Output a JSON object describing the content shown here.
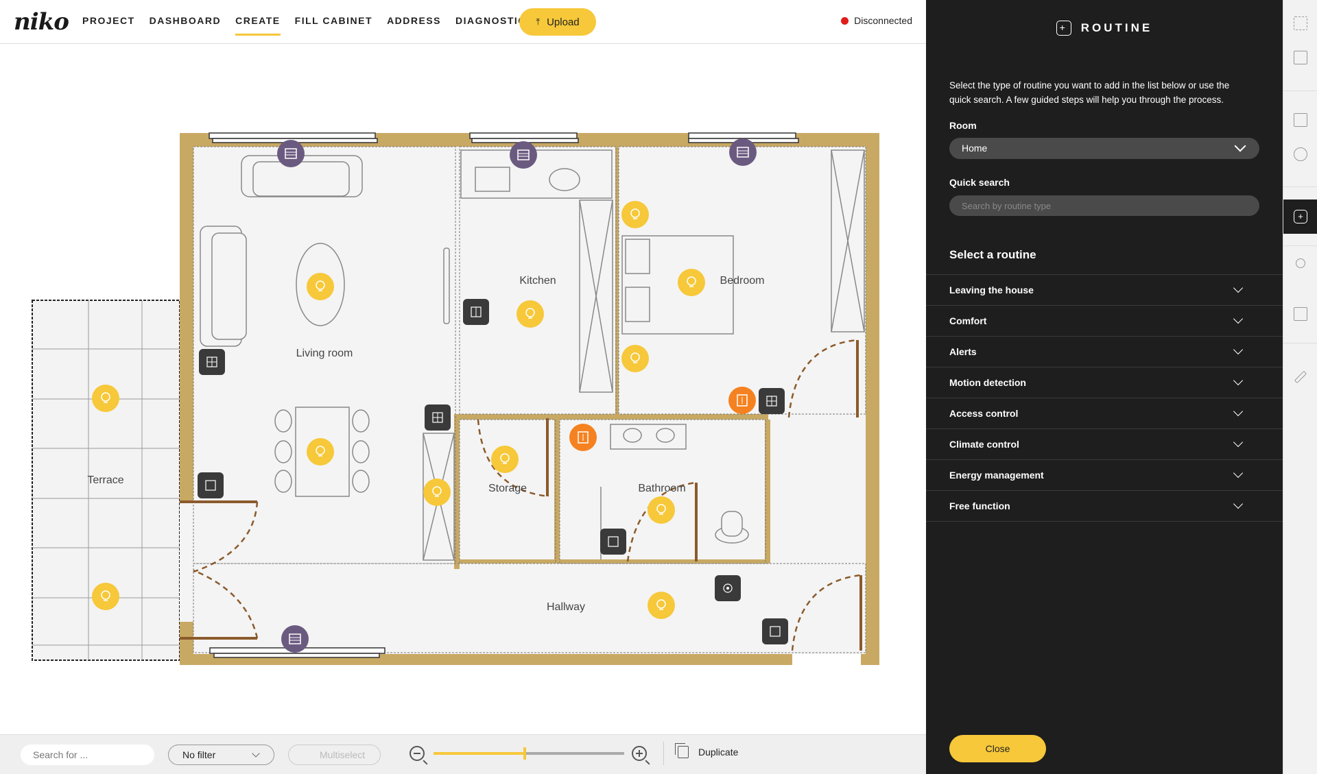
{
  "header": {
    "logo": "niko",
    "nav": [
      "PROJECT",
      "DASHBOARD",
      "CREATE",
      "FILL CABINET",
      "ADDRESS",
      "DIAGNOSTICS"
    ],
    "active_nav": "CREATE",
    "upload_label": "Upload",
    "status_text": "Disconnected",
    "status_color": "#e21b1b"
  },
  "plan": {
    "rooms": {
      "living": "Living room",
      "kitchen": "Kitchen",
      "bedroom": "Bedroom",
      "terrace": "Terrace",
      "storage": "Storage",
      "bathroom": "Bathroom",
      "hallway": "Hallway"
    },
    "wall_color": "#c8a964",
    "light_color": "#f6c83a",
    "blind_color": "#6b5a80",
    "hvac_color": "#f58220"
  },
  "bottombar": {
    "search_placeholder": "Search for ...",
    "filter_value": "No filter",
    "multiselect_label": "Multiselect",
    "zoom_level": 0.48,
    "duplicate_label": "Duplicate"
  },
  "panel": {
    "title": "ROUTINE",
    "intro": "Select the type of routine you want to add in the list below or use the quick search. A few guided steps will help you through the process.",
    "room_label": "Room",
    "room_value": "Home",
    "quick_search_label": "Quick search",
    "quick_search_placeholder": "Search by routine type",
    "select_title": "Select a routine",
    "routines": [
      "Leaving the house",
      "Comfort",
      "Alerts",
      "Motion detection",
      "Access control",
      "Climate control",
      "Energy management",
      "Free function"
    ],
    "close_label": "Close"
  },
  "rail": {
    "icons": [
      "fullscreen-icon",
      "map-icon",
      "add-device-icon",
      "add-group-icon",
      "routine-icon",
      "connections-icon",
      "calendar-icon",
      "tools-icon"
    ]
  }
}
